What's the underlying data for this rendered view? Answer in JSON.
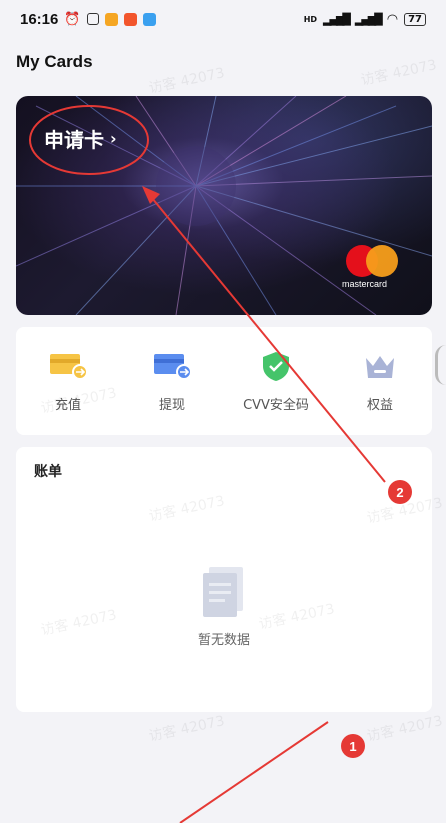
{
  "status_bar": {
    "time": "16:16",
    "battery": "77",
    "network": "HD"
  },
  "page": {
    "title": "My Cards"
  },
  "card": {
    "apply_label": "申请卡",
    "chevron": "›",
    "brand": "mastercard"
  },
  "actions": [
    {
      "label": "充值",
      "icon": "card-deposit-icon",
      "color": "#f6c445"
    },
    {
      "label": "提现",
      "icon": "card-withdraw-icon",
      "color": "#5b8def"
    },
    {
      "label": "CVV安全码",
      "icon": "shield-check-icon",
      "color": "#45c46a"
    },
    {
      "label": "权益",
      "icon": "crown-icon",
      "color": "#a9b3d6"
    }
  ],
  "bill": {
    "title": "账单",
    "empty_text": "暂无数据"
  },
  "watermark_text": "访客 42073",
  "annotations": {
    "badge1": "1",
    "badge2": "2",
    "color": "#e53935"
  }
}
